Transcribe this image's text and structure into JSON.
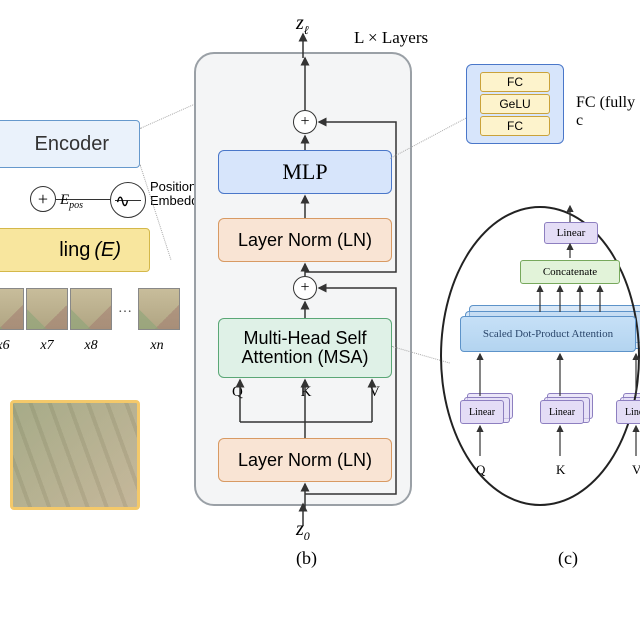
{
  "panel_a": {
    "encoder_label": "Encoder",
    "epos": "E",
    "epos_sub": "pos",
    "pos_embed_label": "Positional\nEmbedding",
    "embedding_label": "ling",
    "embedding_E": "(E)",
    "patch_labels": [
      "x6",
      "x7",
      "x8",
      "xn"
    ],
    "ellipsis": "…"
  },
  "panel_b": {
    "z_out": "z",
    "z_out_sub": "ℓ",
    "z_in": "z",
    "z_in_sub": "0",
    "repeat_label": "L × Layers",
    "mlp": "MLP",
    "ln": "Layer Norm (LN)",
    "msa_l1": "Multi-Head Self",
    "msa_l2": "Attention (MSA)",
    "q": "Q",
    "k": "K",
    "v": "V",
    "caption": "(b)"
  },
  "panel_c": {
    "fc_rows": [
      "FC",
      "GeLU",
      "FC"
    ],
    "fc_side": "FC (fully c",
    "linear": "Linear",
    "concat": "Concatenate",
    "sdpa": "Scaled Dot-Product Attention",
    "q": "Q",
    "k": "K",
    "v": "V",
    "caption": "(c)"
  }
}
